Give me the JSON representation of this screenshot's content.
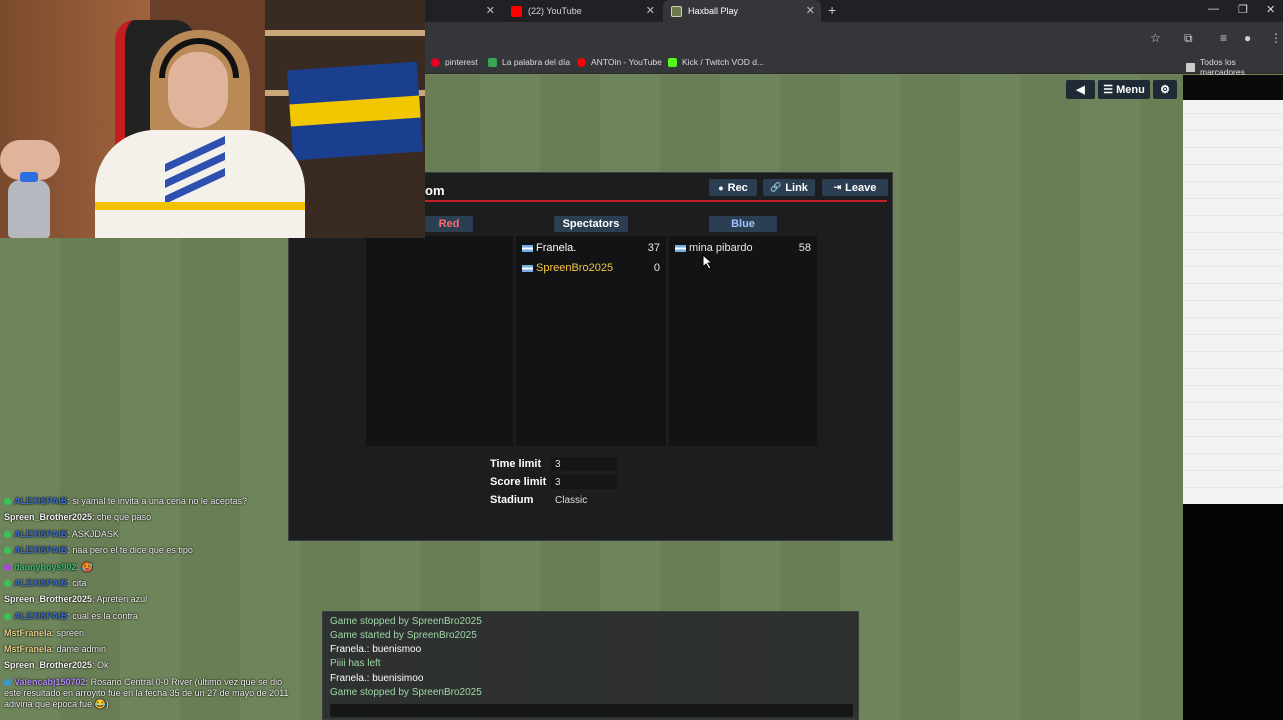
{
  "browser": {
    "tabs": [
      {
        "label": "",
        "kind": "partial"
      },
      {
        "label": "(22) YouTube",
        "kind": "youtube"
      },
      {
        "label": "Haxball Play",
        "kind": "haxball",
        "active": true
      }
    ],
    "new_tab": "+",
    "bookmarks": [
      {
        "label": "pinterest",
        "color": "#e60023"
      },
      {
        "label": "La palabra del día",
        "color": "#3aa757"
      },
      {
        "label": "ANTOin - YouTube",
        "color": "#ff0000"
      },
      {
        "label": "Kick / Twitch VOD d...",
        "color": "#53fc18"
      },
      {
        "label": "Todos los marcadores",
        "color": "#cccccc"
      }
    ]
  },
  "game": {
    "top_menu": {
      "back_icon": "◀",
      "menu_label": "Menu",
      "settings_icon": "⚙"
    },
    "room": {
      "title_partial": "om",
      "buttons": {
        "rec": "Rec",
        "link": "Link",
        "leave": "Leave"
      },
      "columns": {
        "red": "Red",
        "spectators": "Spectators",
        "blue": "Blue"
      },
      "spectators": [
        {
          "name": "Franela.",
          "ping": "37",
          "color": "#ffffff"
        },
        {
          "name": "SpreenBro2025",
          "ping": "0",
          "color": "#f5c542"
        }
      ],
      "blue": [
        {
          "name": "mina pibardo",
          "ping": "58",
          "color": "#ffffff"
        }
      ],
      "settings": [
        {
          "label": "Time limit",
          "value": "3"
        },
        {
          "label": "Score limit",
          "value": "3"
        },
        {
          "label": "Stadium",
          "value": "Classic"
        }
      ]
    },
    "chat": [
      {
        "text": "Game stopped by SpreenBro2025",
        "color": "#9fd7a8"
      },
      {
        "text": "Game started by SpreenBro2025",
        "color": "#9fd7a8"
      },
      {
        "text": "Franela.: buenismoo",
        "color": "#ffffff"
      },
      {
        "text": "Piiii has left",
        "color": "#9fd7a8"
      },
      {
        "text": "Franela.: buenisimoo",
        "color": "#ffffff"
      },
      {
        "text": "Game stopped by SpreenBro2025",
        "color": "#9fd7a8"
      }
    ]
  },
  "stream_chat": [
    {
      "user": "ALEXISPAIB",
      "msg": ": si yamal te invita a una cena no le aceptas?",
      "color": "#3b6fd6",
      "badge": true
    },
    {
      "user": "Spreen_Brother2025",
      "msg": ": che que paso",
      "color": "#f2f2f2",
      "badge": false
    },
    {
      "user": "ALEXISPAIB",
      "msg": ": ASKJDASK",
      "color": "#3b6fd6",
      "badge": true
    },
    {
      "user": "ALEXISPAIB",
      "msg": ": naa pero el te dice que es tipo",
      "color": "#3b6fd6",
      "badge": true
    },
    {
      "user": "dannyboys902",
      "msg": ": 🥵",
      "color": "#41c07a",
      "badge": true
    },
    {
      "user": "ALEXISPAIB",
      "msg": ": cita",
      "color": "#3b6fd6",
      "badge": true
    },
    {
      "user": "Spreen_Brother2025",
      "msg": ": Apreten azul",
      "color": "#f2f2f2",
      "badge": false
    },
    {
      "user": "ALEXISPAIB",
      "msg": ": cual es la contra",
      "color": "#3b6fd6",
      "badge": true
    },
    {
      "user": "MstFranela",
      "msg": ": spreen",
      "color": "#e8d08c",
      "badge": false
    },
    {
      "user": "MstFranela",
      "msg": ": dame admin",
      "color": "#e8d08c",
      "badge": false
    },
    {
      "user": "Spreen_Brother2025",
      "msg": ": Ok",
      "color": "#f2f2f2",
      "badge": false
    },
    {
      "user": "Valencabj150702",
      "msg": ": Rosario Central 0-0 River (último vez que se dio este resultado en arroyito fue en la fecha 35 de un 27 de mayo de 2011 adivina que época fue 😂)",
      "color": "#b28cff",
      "badge": true
    }
  ]
}
